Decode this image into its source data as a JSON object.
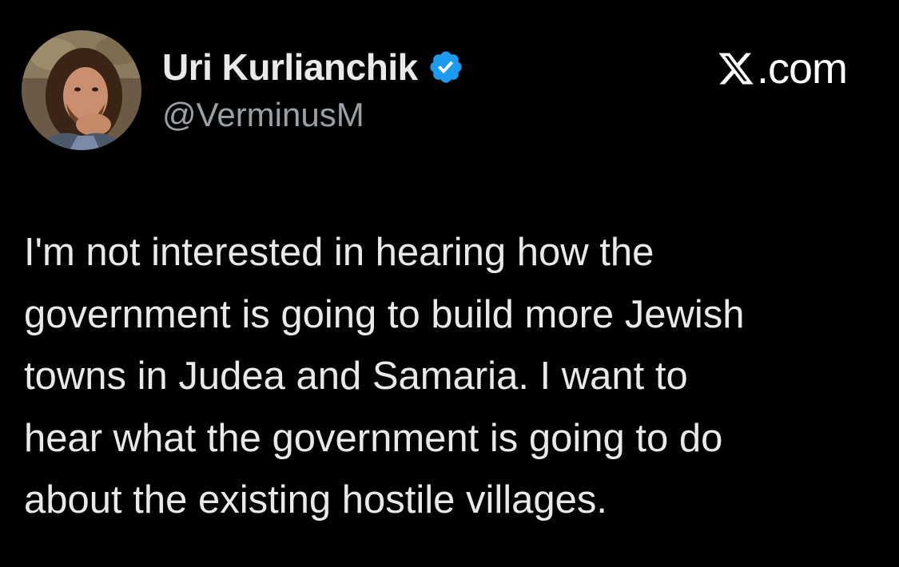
{
  "author": {
    "name": "Uri Kurlianchik",
    "handle": "@VerminusM",
    "verified_icon": "verified-badge-icon",
    "avatar": "profile-photo"
  },
  "brand": {
    "icon": "x-logo-icon",
    "suffix": ".com"
  },
  "tweet": {
    "lines": [
      "I'm not interested in hearing how the",
      "government is going to build more Jewish",
      "towns in Judea and Samaria. I want to",
      "hear what the government is going to do",
      "about the existing hostile villages."
    ]
  },
  "colors": {
    "background": "#000000",
    "text": "#e7e9ea",
    "handle": "#9aa0a6",
    "verified": "#1d9bf0"
  }
}
